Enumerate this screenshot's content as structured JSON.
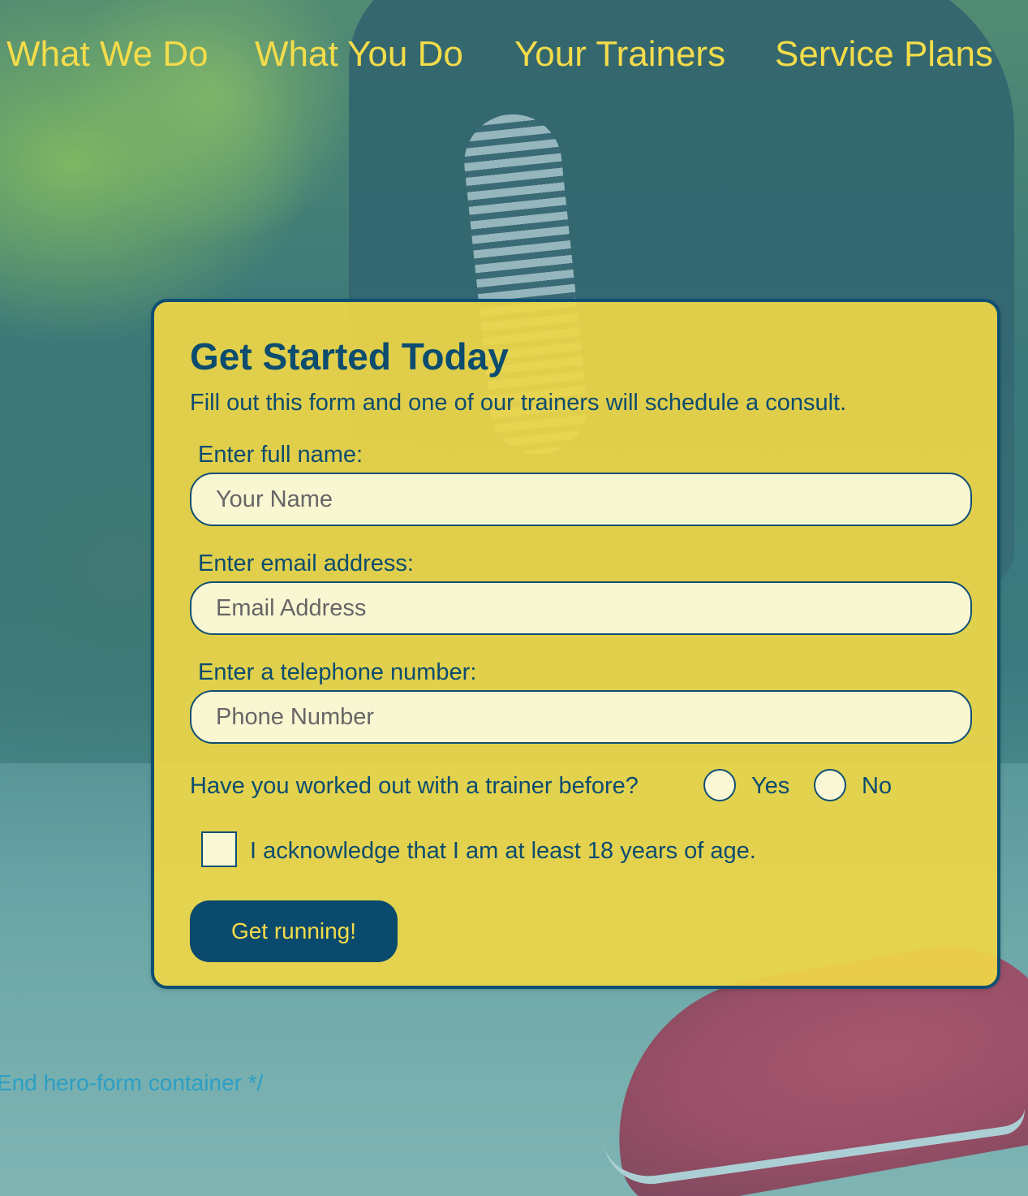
{
  "nav": {
    "items": [
      {
        "label": "What We Do"
      },
      {
        "label": "What You Do"
      },
      {
        "label": "Your Trainers"
      },
      {
        "label": "Service Plans"
      }
    ]
  },
  "form": {
    "title": "Get Started Today",
    "subtitle": "Fill out this form and one of our trainers will schedule a consult.",
    "fields": [
      {
        "label": "Enter full name:",
        "placeholder": "Your Name",
        "value": ""
      },
      {
        "label": "Enter email address:",
        "placeholder": "Email Address",
        "value": ""
      },
      {
        "label": "Enter a telephone number:",
        "placeholder": "Phone Number",
        "value": ""
      }
    ],
    "question": "Have you worked out with a trainer before?",
    "options": [
      {
        "label": "Yes",
        "selected": false
      },
      {
        "label": "No",
        "selected": false
      }
    ],
    "acknowledge": "I acknowledge that I am at least 18 years of age.",
    "acknowledge_checked": false,
    "submit_label": "Get running!"
  },
  "stray_text": "End hero-form container */",
  "colors": {
    "nav_text": "#f4dc4a",
    "card_bg": "#eed648",
    "card_border": "#0f4f73",
    "text_primary": "#0c4c6f",
    "button_bg": "#0a4a6d",
    "button_text": "#f4dc4a",
    "comment_text": "#2c9fc6"
  }
}
